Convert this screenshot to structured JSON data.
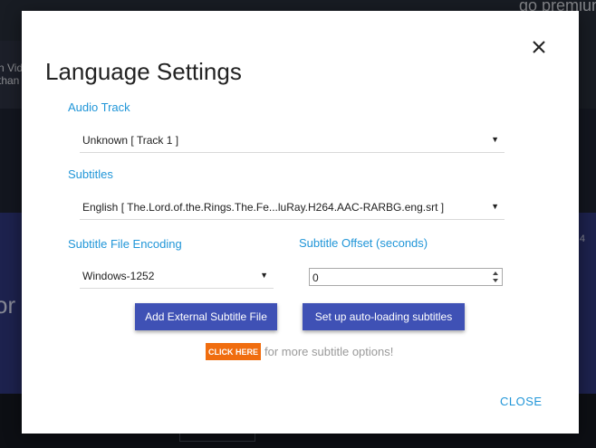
{
  "background": {
    "premium_text": "go premium",
    "left_text_line1": "n Vid",
    "left_text_line2": "than",
    "big_text": "or",
    "right_digits": "4"
  },
  "dialog": {
    "title": "Language Settings",
    "close_icon": "close-icon",
    "audio_track": {
      "label": "Audio Track",
      "selected": "Unknown [ Track 1 ]"
    },
    "subtitles": {
      "label": "Subtitles",
      "selected": "English [ The.Lord.of.the.Rings.The.Fe...luRay.H264.AAC-RARBG.eng.srt ]"
    },
    "encoding": {
      "label": "Subtitle File Encoding",
      "selected": "Windows-1252"
    },
    "offset": {
      "label": "Subtitle Offset (seconds)",
      "value": "0"
    },
    "buttons": {
      "add_external": "Add External Subtitle File",
      "auto_loading": "Set up auto-loading subtitles"
    },
    "click_here": "CLICK HERE",
    "more_options_text": "for more subtitle options!",
    "close_label": "CLOSE"
  },
  "colors": {
    "accent_blue": "#2196d8",
    "button_indigo": "#3f51b5",
    "orange": "#f06d0f"
  }
}
